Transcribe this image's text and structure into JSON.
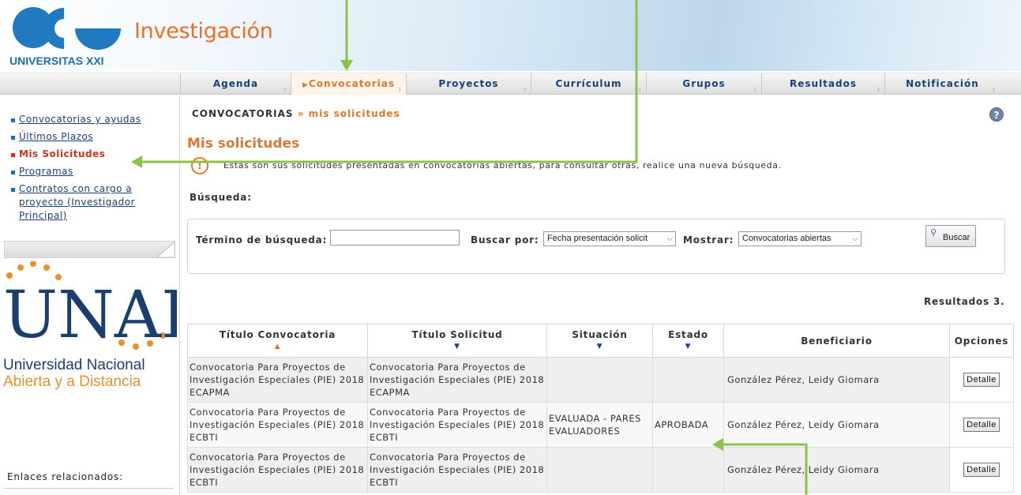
{
  "header": {
    "brand": "Investigación",
    "org": "UNIVERSITAS XXI"
  },
  "nav": {
    "items": [
      {
        "label": "Agenda"
      },
      {
        "label": "Convocatorias",
        "active": true
      },
      {
        "label": "Proyectos"
      },
      {
        "label": "Currículum"
      },
      {
        "label": "Grupos"
      },
      {
        "label": "Resultados"
      },
      {
        "label": "Notificación"
      }
    ]
  },
  "sidebar": {
    "items": [
      {
        "label": "Convocatorias y ayudas"
      },
      {
        "label": "Últimos Plazos"
      },
      {
        "label": "Mis Solicitudes",
        "active": true
      },
      {
        "label": "Programas"
      },
      {
        "label": "Contratos con cargo a proyecto (Investigador Principal)"
      }
    ],
    "institution": {
      "logo_text": "UNAD",
      "name_line1": "Universidad Nacional",
      "name_line2": "Abierta y a  Distancia"
    },
    "related_links_label": "Enlaces relacionados:"
  },
  "breadcrumb": {
    "section": "CONVOCATORIAS",
    "separator": "»",
    "current": "mis solicitudes"
  },
  "main": {
    "title": "Mis solicitudes",
    "info": "Estas son sus solicitudes presentadas en convocatorias abiertas, para consultar otras, realice una nueva búsqueda.",
    "search_heading": "Búsqueda:",
    "results_text": "Resultados 3."
  },
  "search": {
    "term_label": "Término de búsqueda:",
    "term_value": "",
    "search_by_label": "Buscar por:",
    "search_by_value": "Fecha presentación solicit",
    "show_label": "Mostrar:",
    "show_value": "Convocatorias abiertas",
    "button_label": "Buscar"
  },
  "table": {
    "columns": [
      {
        "label": "Título Convocatoria",
        "sort": "asc"
      },
      {
        "label": "Título Solicitud",
        "sort": "desc"
      },
      {
        "label": "Situación",
        "sort": "desc"
      },
      {
        "label": "Estado",
        "sort": "desc"
      },
      {
        "label": "Beneficiario",
        "sort": ""
      },
      {
        "label": "Opciones",
        "sort": ""
      }
    ],
    "rows": [
      {
        "convocatoria": "Convocatoria Para Proyectos de Investigación Especiales (PIE) 2018 ECAPMA",
        "solicitud": "Convocatoria Para Proyectos de Investigación Especiales (PIE) 2018 ECAPMA",
        "situacion": "",
        "estado": "",
        "beneficiario": "González Pérez, Leidy Giomara",
        "opcion": "Detalle"
      },
      {
        "convocatoria": "Convocatoria Para Proyectos de Investigación Especiales (PIE) 2018 ECBTI",
        "solicitud": "Convocatoria Para Proyectos de Investigación Especiales (PIE) 2018 ECBTI",
        "situacion": "EVALUADA - PARES EVALUADORES",
        "estado": "APROBADA",
        "beneficiario": "González Pérez, Leidy Giomara",
        "opcion": "Detalle"
      },
      {
        "convocatoria": "Convocatoria Para Proyectos de Investigación Especiales (PIE) 2018 ECBTI",
        "solicitud": "Convocatoria Para Proyectos de Investigación Especiales (PIE) 2018 ECBTI",
        "situacion": "",
        "estado": "",
        "beneficiario": "González Pérez, Leidy Giomara",
        "opcion": "Detalle"
      }
    ]
  },
  "colors": {
    "accent": "#e0772f",
    "link": "#1a3f7a",
    "annotation": "#8bc34a"
  }
}
